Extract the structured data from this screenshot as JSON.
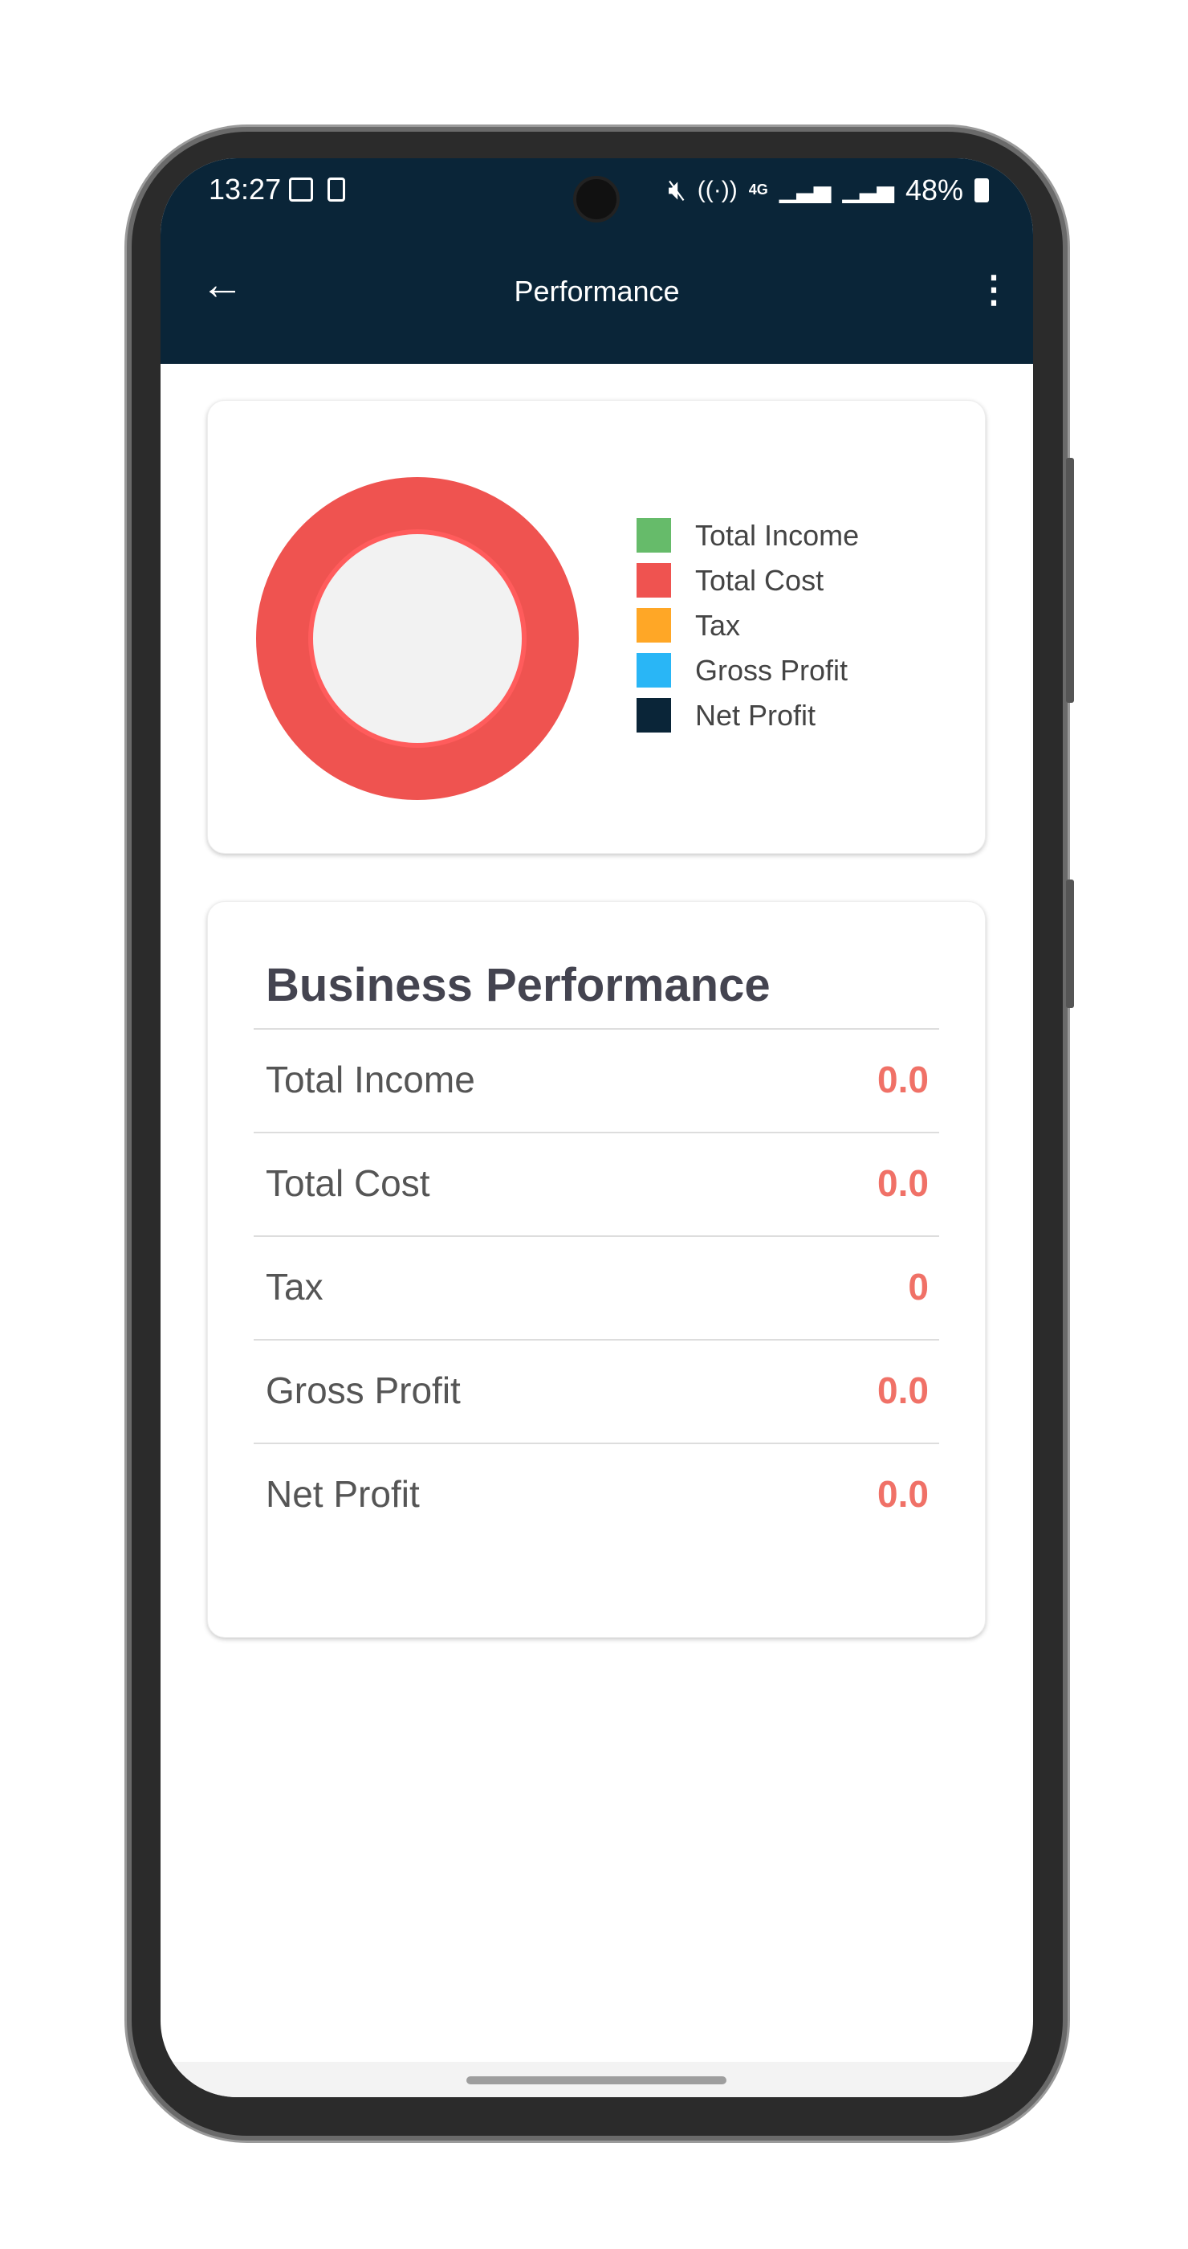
{
  "status_bar": {
    "time": "13:27",
    "battery": "48%",
    "network": "4G",
    "icons": [
      "image-icon",
      "sim-icon",
      "mute-icon",
      "hotspot-icon",
      "signal-icon",
      "signal-icon",
      "battery-charging-icon"
    ]
  },
  "header": {
    "title": "Performance",
    "back_icon": "arrow-left-icon",
    "menu_icon": "more-vertical-icon"
  },
  "chart_data": {
    "type": "pie",
    "style": "donut",
    "categories": [
      "Total Income",
      "Total Cost",
      "Tax",
      "Gross Profit",
      "Net Profit"
    ],
    "values": [
      0.0,
      0.0,
      0,
      0.0,
      0.0
    ],
    "colors": [
      "#66bb6a",
      "#ef5350",
      "#ffa726",
      "#29b6f6",
      "#0a2538"
    ],
    "rendered_fill": "#ef5350",
    "legend_placement": "right"
  },
  "business": {
    "title": "Business Performance",
    "rows": [
      {
        "label": "Total Income",
        "value": "0.0"
      },
      {
        "label": "Total Cost",
        "value": "0.0"
      },
      {
        "label": "Tax",
        "value": "0"
      },
      {
        "label": "Gross Profit",
        "value": "0.0"
      },
      {
        "label": "Net Profit",
        "value": "0.0"
      }
    ],
    "value_color": "#f07167"
  }
}
